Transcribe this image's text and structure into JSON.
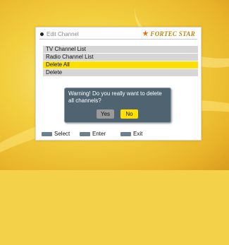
{
  "screen": {
    "title": "Edit Channel",
    "brand": "FORTEC STAR"
  },
  "menu": {
    "items": [
      {
        "label": "TV Channel List",
        "selected": false
      },
      {
        "label": "Radio Channel List",
        "selected": false
      },
      {
        "label": "Delete All",
        "selected": true
      },
      {
        "label": "Delete",
        "selected": false
      }
    ]
  },
  "dialog": {
    "message": "Warning! Do you really want to delete all channels?",
    "yes_label": "Yes",
    "no_label": "No"
  },
  "footer": {
    "select_label": "Select",
    "enter_label": "Enter",
    "exit_label": "Exit"
  },
  "colors": {
    "accent_selected": "#ffe000",
    "dialog_bg": "#4f6470"
  }
}
